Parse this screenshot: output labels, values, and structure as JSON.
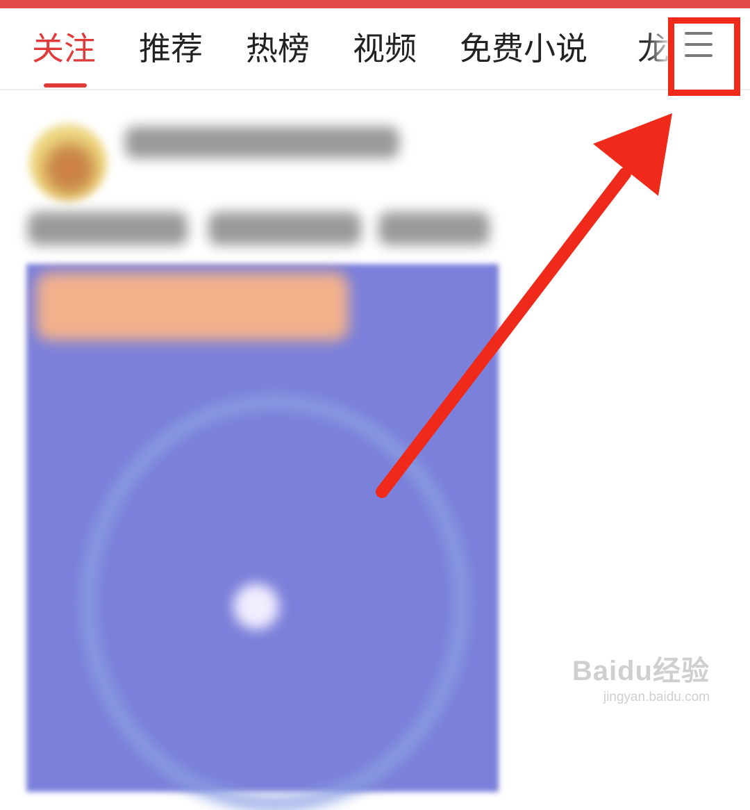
{
  "tabs": [
    {
      "label": "关注",
      "active": true
    },
    {
      "label": "推荐",
      "active": false
    },
    {
      "label": "热榜",
      "active": false
    },
    {
      "label": "视频",
      "active": false
    },
    {
      "label": "免费小说",
      "active": false
    },
    {
      "label": "龙",
      "active": false
    }
  ],
  "menu_icon": "hamburger-menu-icon",
  "annotation_color": "#f02a1a",
  "accent_color": "#e03a3a",
  "watermark": {
    "logo": "Baidu经验",
    "url": "jingyan.baidu.com"
  }
}
